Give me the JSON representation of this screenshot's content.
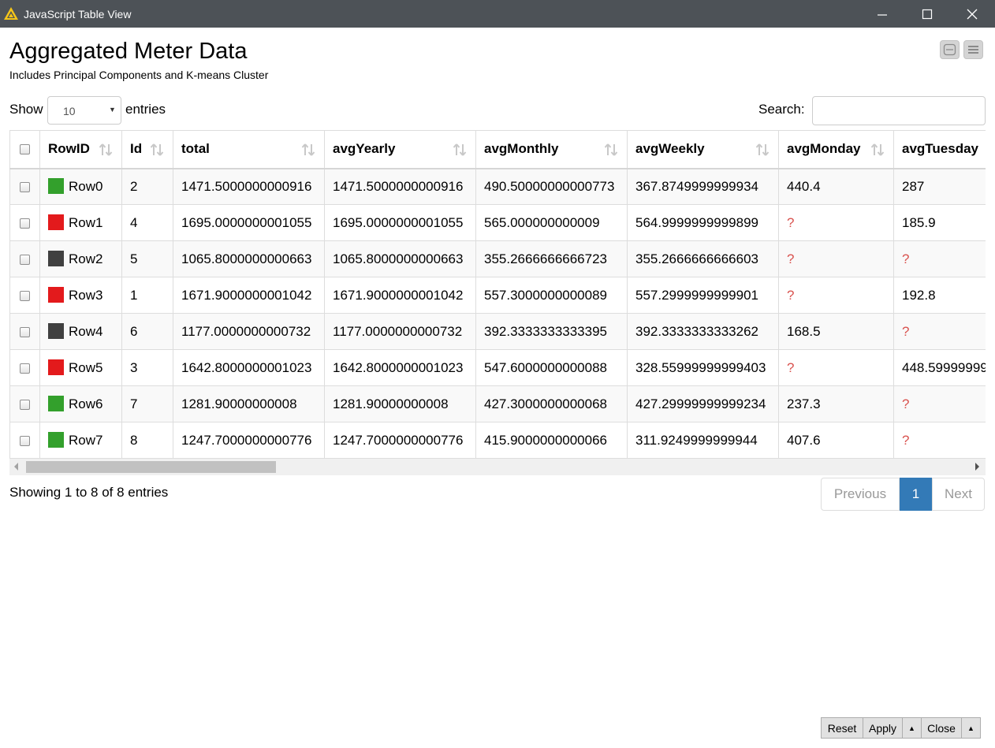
{
  "window": {
    "title": "JavaScript Table View"
  },
  "view": {
    "title": "Aggregated Meter Data",
    "subtitle": "Includes Principal Components and K-means Cluster"
  },
  "controls": {
    "show_label": "Show",
    "entries_value": "10",
    "entries_label": "entries",
    "search_label": "Search:",
    "search_value": ""
  },
  "table": {
    "columns": [
      "RowID",
      "Id",
      "total",
      "avgYearly",
      "avgMonthly",
      "avgWeekly",
      "avgMonday",
      "avgTuesday"
    ],
    "rows": [
      {
        "cluster_color": "#33a02c",
        "cells": [
          "Row0",
          "2",
          "1471.5000000000916",
          "1471.5000000000916",
          "490.50000000000773",
          "367.8749999999934",
          "440.4",
          "287"
        ]
      },
      {
        "cluster_color": "#e31a1c",
        "cells": [
          "Row1",
          "4",
          "1695.0000000001055",
          "1695.0000000001055",
          "565.000000000009",
          "564.9999999999899",
          "?",
          "185.9"
        ]
      },
      {
        "cluster_color": "#404040",
        "cells": [
          "Row2",
          "5",
          "1065.8000000000663",
          "1065.8000000000663",
          "355.2666666666723",
          "355.2666666666603",
          "?",
          "?"
        ]
      },
      {
        "cluster_color": "#e31a1c",
        "cells": [
          "Row3",
          "1",
          "1671.9000000001042",
          "1671.9000000001042",
          "557.3000000000089",
          "557.2999999999901",
          "?",
          "192.8"
        ]
      },
      {
        "cluster_color": "#404040",
        "cells": [
          "Row4",
          "6",
          "1177.0000000000732",
          "1177.0000000000732",
          "392.3333333333395",
          "392.3333333333262",
          "168.5",
          "?"
        ]
      },
      {
        "cluster_color": "#e31a1c",
        "cells": [
          "Row5",
          "3",
          "1642.8000000001023",
          "1642.8000000001023",
          "547.6000000000088",
          "328.55999999999403",
          "?",
          "448.5999999999"
        ]
      },
      {
        "cluster_color": "#33a02c",
        "cells": [
          "Row6",
          "7",
          "1281.90000000008",
          "1281.90000000008",
          "427.3000000000068",
          "427.29999999999234",
          "237.3",
          "?"
        ]
      },
      {
        "cluster_color": "#33a02c",
        "cells": [
          "Row7",
          "8",
          "1247.7000000000776",
          "1247.7000000000776",
          "415.9000000000066",
          "311.9249999999944",
          "407.6",
          "?"
        ]
      }
    ]
  },
  "footer_info": "Showing 1 to 8 of 8 entries",
  "pagination": {
    "previous": "Previous",
    "current": "1",
    "next": "Next"
  },
  "buttons": {
    "reset": "Reset",
    "apply": "Apply",
    "close": "Close"
  },
  "colors": {
    "accent": "#337ab7",
    "missing": "#d9534f",
    "titlebar": "#4d5257"
  }
}
